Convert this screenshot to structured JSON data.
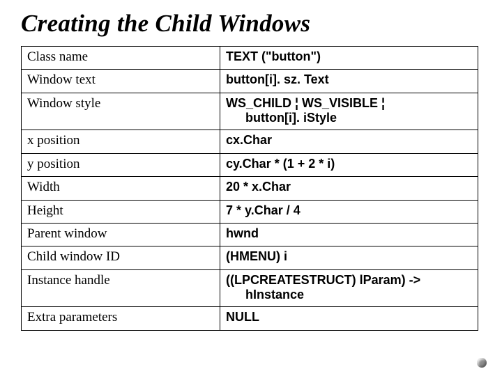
{
  "title": "Creating the Child Windows",
  "rows": [
    {
      "label": "Class name",
      "value": "TEXT (\"button\")"
    },
    {
      "label": "Window text",
      "value": "button[i]. sz. Text"
    },
    {
      "label": "Window style",
      "value": "WS_CHILD ¦ WS_VISIBLE ¦",
      "value2": "button[i]. iStyle"
    },
    {
      "label": "x position",
      "value": "cx.Char"
    },
    {
      "label": "y position",
      "value": "cy.Char * (1 + 2 * i)"
    },
    {
      "label": "Width",
      "value": "20 * x.Char"
    },
    {
      "label": "Height",
      "value": "7 * y.Char / 4"
    },
    {
      "label": "Parent window",
      "value": "hwnd"
    },
    {
      "label": "Child window ID",
      "value": "(HMENU) i"
    },
    {
      "label": "Instance handle",
      "value": "((LPCREATESTRUCT) lParam) ->",
      "value2": "hInstance"
    },
    {
      "label": "Extra parameters",
      "value": "NULL"
    }
  ]
}
